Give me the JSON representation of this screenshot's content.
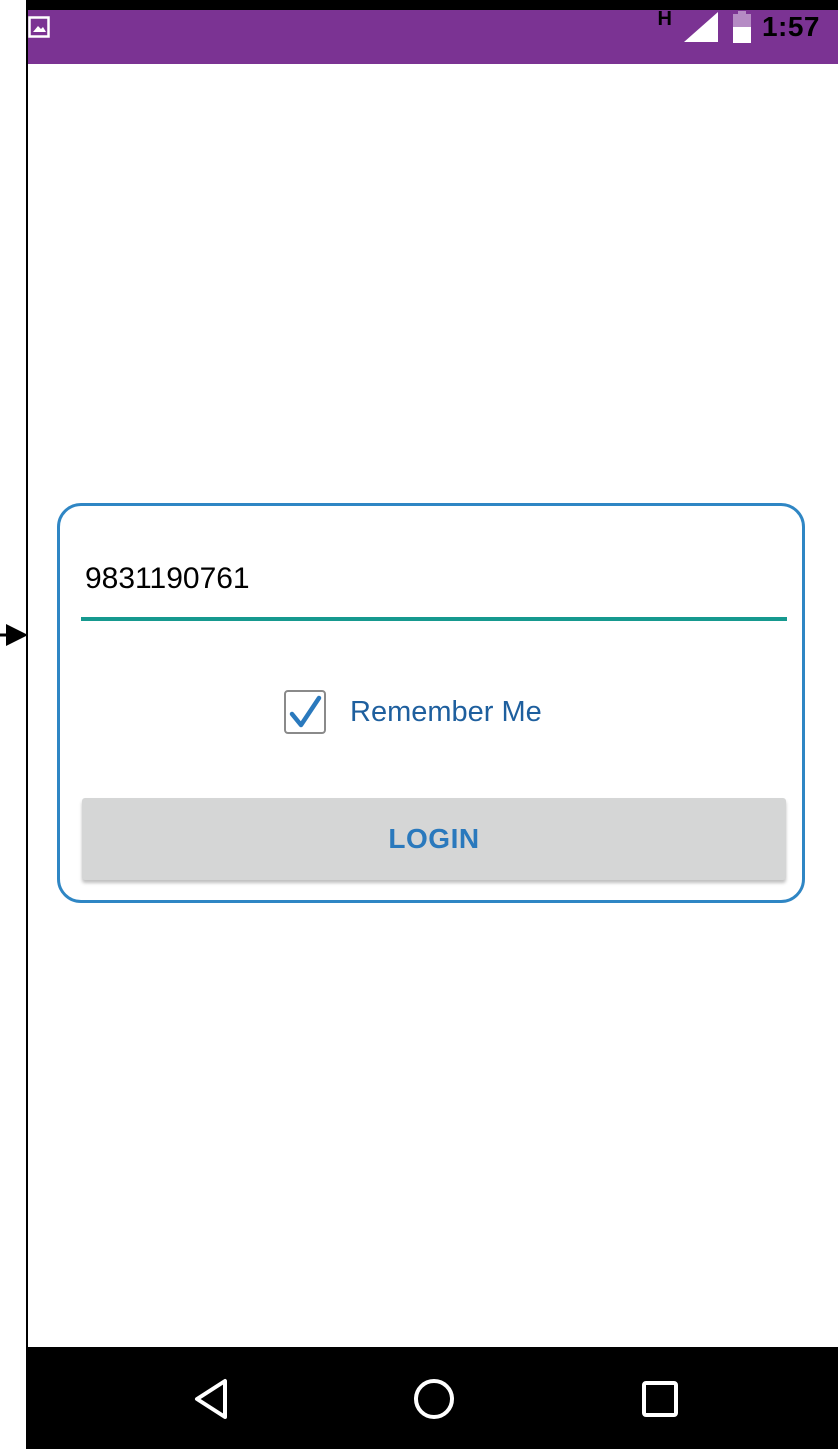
{
  "status_bar": {
    "network_label": "H",
    "time": "1:57",
    "icons": [
      "image-notification-icon",
      "signal-icon",
      "battery-icon"
    ]
  },
  "login_form": {
    "phone_value": "9831190761",
    "remember_me_label": "Remember Me",
    "remember_me_checked": true,
    "login_label": "LOGIN"
  },
  "nav_bar": {
    "icons": [
      "back-icon",
      "home-icon",
      "recents-icon"
    ]
  },
  "colors": {
    "status_bar": "#7b3393",
    "card_border": "#2f86c4",
    "input_underline": "#16998f",
    "button_background": "#d5d6d6",
    "button_text": "#2a79bd",
    "label_text": "#1e5f9e"
  }
}
